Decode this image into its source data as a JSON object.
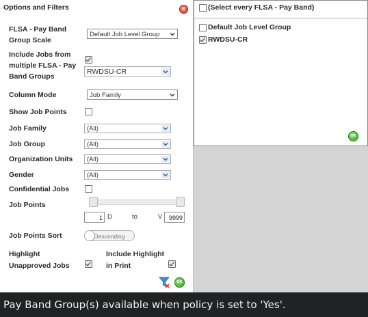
{
  "panel": {
    "title": "Options and Filters",
    "close_glyph": "×"
  },
  "fields": {
    "flsa_scale_label_1": "FLSA - Pay Band",
    "flsa_scale_label_2": "Group Scale",
    "flsa_scale_value": "Default Job Level Group",
    "include_jobs_label_1": "Include Jobs from",
    "include_jobs_label_2": "multiple FLSA - Pay",
    "include_jobs_label_3": "Band Groups",
    "include_jobs_checked": true,
    "pay_band_group_value": "RWDSU-CR",
    "column_mode_label": "Column Mode",
    "column_mode_value": "Job Family",
    "show_job_points_label": "Show Job Points",
    "show_job_points_checked": false,
    "job_family_label": "Job Family",
    "job_family_value": "(All)",
    "job_group_label": "Job Group",
    "job_group_value": "(All)",
    "org_units_label": "Organization Units",
    "org_units_value": "(All)",
    "gender_label": "Gender",
    "gender_value": "(All)",
    "confidential_label": "Confidential Jobs",
    "confidential_checked": false,
    "job_points_label": "Job Points",
    "job_points_min": "1",
    "job_points_min_suffix": "D",
    "job_points_to": "to",
    "job_points_max_prefix": "V",
    "job_points_max": "9999",
    "job_points_sort_label": "Job Points Sort",
    "job_points_sort_value": "Descending",
    "highlight_label_1": "Highlight",
    "highlight_label_2": "Unapproved Jobs",
    "highlight_checked": true,
    "include_highlight_label_1": "Include Highlight",
    "include_highlight_label_2": "in Print",
    "include_highlight_checked": true,
    "ok_text": "OK"
  },
  "dropdown_list": {
    "select_all_label": "(Select every FLSA - Pay Band)",
    "select_all_checked": false,
    "items": [
      {
        "label": "Default Job Level Group",
        "checked": false
      },
      {
        "label": "RWDSU-CR",
        "checked": true
      }
    ],
    "ok_text": "OK"
  },
  "tooltip": {
    "text": "Pay Band Group(s) available when policy is set to 'Yes'."
  },
  "icons": {
    "close": "close-icon",
    "ok": "ok-icon",
    "filter": "filter-icon",
    "chevron": "chevron-down-icon"
  },
  "colors": {
    "close_red": "#c8321e",
    "ok_green": "#2f9a1c",
    "tooltip_bg": "#202224",
    "select_arrow_bg": "#e2ebf6"
  }
}
